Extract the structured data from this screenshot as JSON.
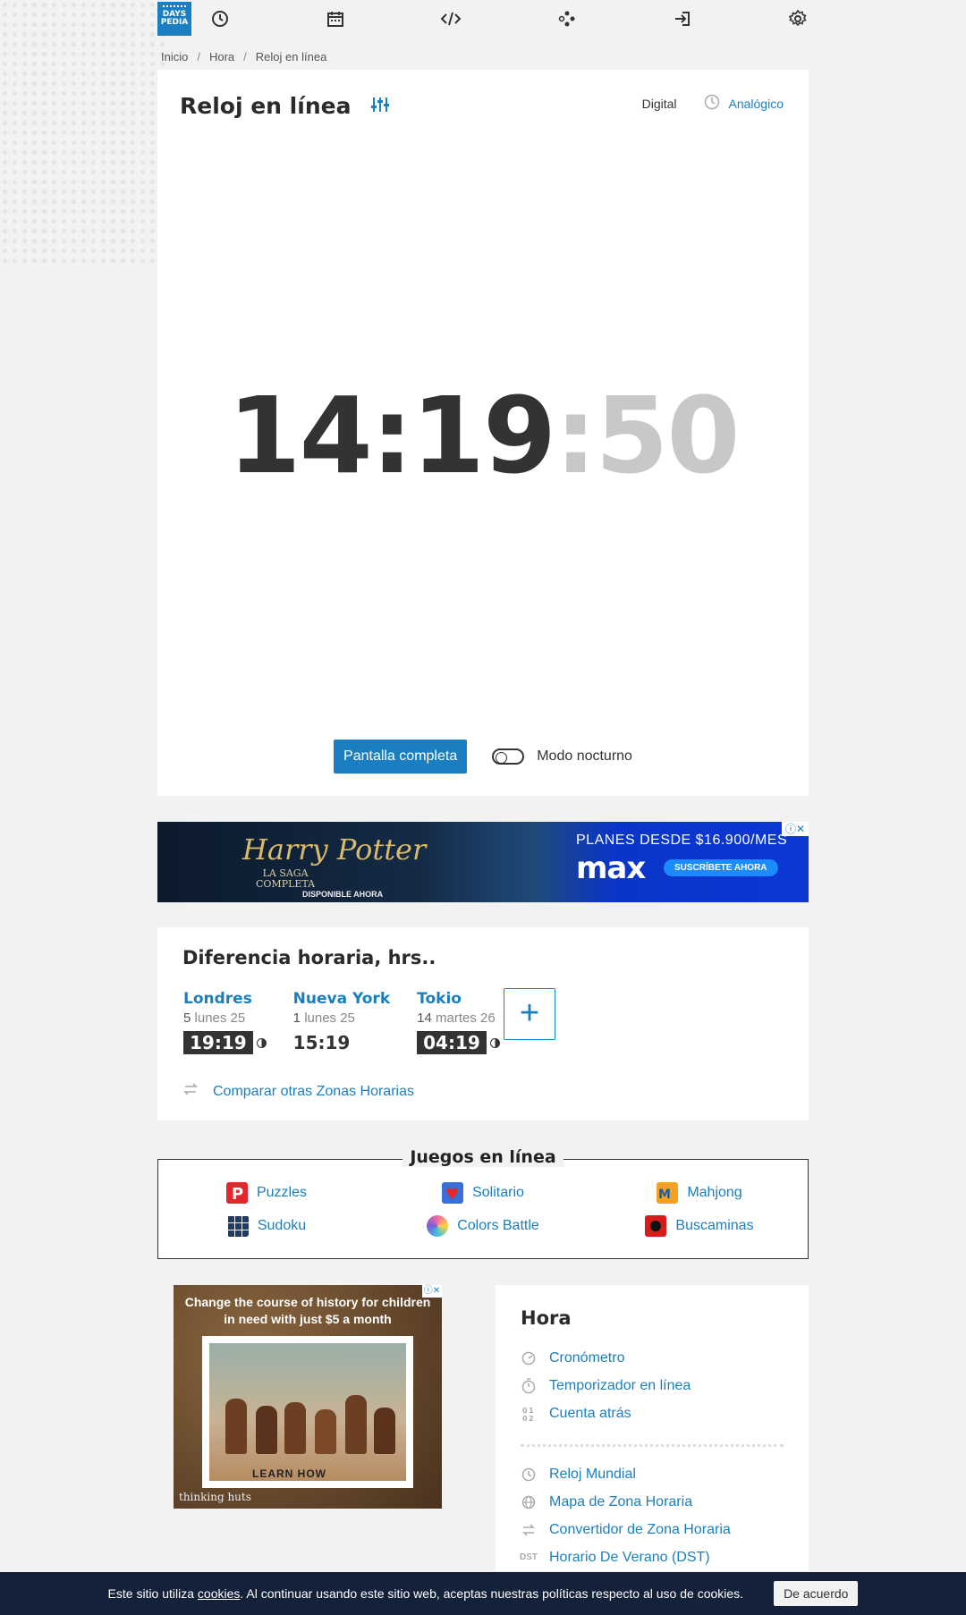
{
  "nav": {
    "logo_top": "DAYS",
    "logo_bottom": "PEDIA",
    "icons": [
      "clock-icon",
      "calendar-icon",
      "code-icon",
      "gamepad-icon",
      "login-icon",
      "gear-icon"
    ]
  },
  "breadcrumb": [
    "Inicio",
    "Hora",
    "Reloj en línea"
  ],
  "clock": {
    "title": "Reloj en línea",
    "mode_digital": "Digital",
    "mode_analog": "Analógico",
    "hours": "14",
    "minutes": "19",
    "seconds": "50",
    "fullscreen_label": "Pantalla completa",
    "night_mode_label": "Modo nocturno"
  },
  "ad1": {
    "title": "Harry Potter",
    "subtitle_1": "LA SAGA",
    "subtitle_2": "COMPLETA",
    "available": "DISPONIBLE AHORA",
    "plans": "PLANES DESDE $16.900/MES",
    "brand": "max",
    "cta": "SUSCRÍBETE AHORA"
  },
  "time_diff": {
    "title": "Diferencia horaria, hrs..",
    "cities": [
      {
        "name": "Londres",
        "diff": "5",
        "date": "lunes 25",
        "time": "19:19",
        "night": true
      },
      {
        "name": "Nueva York",
        "diff": "1",
        "date": "lunes 25",
        "time": "15:19",
        "night": false
      },
      {
        "name": "Tokio",
        "diff": "14",
        "date": "martes 26",
        "time": "04:19",
        "night": true
      }
    ],
    "add_label": "+",
    "compare_label": "Comparar otras Zonas Horarias"
  },
  "games": {
    "title": "Juegos en línea",
    "items": [
      {
        "label": "Puzzles",
        "color": "#e3262b"
      },
      {
        "label": "Solitario",
        "color": "#3a6fd8"
      },
      {
        "label": "Mahjong",
        "color": "#f4a21f"
      },
      {
        "label": "Sudoku",
        "color": "#1f3a66"
      },
      {
        "label": "Colors Battle",
        "color": "#f26aa4"
      },
      {
        "label": "Buscaminas",
        "color": "#d81c1c"
      }
    ]
  },
  "ad2": {
    "headline": "Change the course of history for children in need with just $5 a month",
    "cta": "LEARN HOW",
    "brand": "thinking huts"
  },
  "sidebar": {
    "title": "Hora",
    "group1": [
      "Cronómetro",
      "Temporizador en línea",
      "Cuenta atrás"
    ],
    "group2": [
      "Reloj Mundial",
      "Mapa de Zona Horaria",
      "Convertidor de Zona Horaria",
      "Horario De Verano (DST)"
    ],
    "dst_icon_text": "DST"
  },
  "cookie": {
    "text_before": "Este sitio utiliza ",
    "link": "cookies",
    "text_after": ". Al continuar usando este sitio web, aceptas nuestras políticas respecto al uso de cookies.",
    "accept": "De acuerdo"
  },
  "colors": {
    "accent": "#1a7fc1",
    "dark": "#333333",
    "cookie_bar": "#14213a"
  }
}
